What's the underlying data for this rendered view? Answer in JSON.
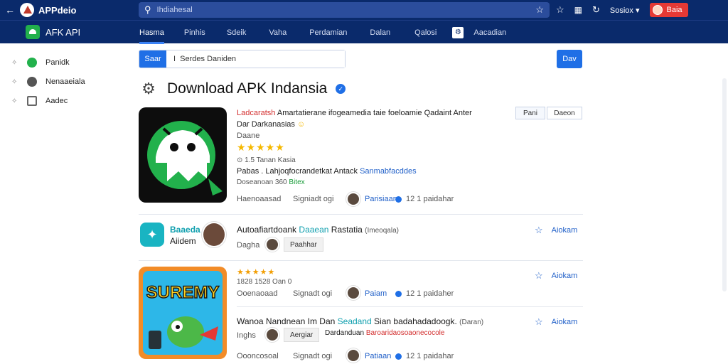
{
  "topbar": {
    "back_icon": "back-arrow-icon",
    "app_name": "APPdeio",
    "search_placeholder": "Ihdiahesal",
    "lang": "Sosiox",
    "user_label": "Baia"
  },
  "navbar": {
    "section": "AFK API",
    "tabs": [
      "Hasma",
      "Pinhis",
      "Sdeik",
      "Vaha",
      "Perdamian",
      "Dalan",
      "Qalosi",
      "Aacadian"
    ]
  },
  "sidebar": {
    "items": [
      "Panidk",
      "Nenaaeiala",
      "Aadec"
    ]
  },
  "filter": {
    "sort_label": "Saar",
    "input_value": "I  Serdes Daniden",
    "dev_label": "Dav"
  },
  "page_title": "Download APK Indansia",
  "featured": {
    "title_red": "Ladcaratsh",
    "title_rest": "Amartatierane ifogeamedia taie  foeloamie Qadaint Anter",
    "subtitle": "Dar Darkanasias",
    "category": "Daane",
    "rating_stars": 5,
    "meta": "⊙  1.5  Tanan Kasia",
    "desc_dark": "Pabas . Lahjoqfocrandetkat Antack",
    "desc_blue": "Sanmabfacddes",
    "size_dark": "Doseanoan 360",
    "size_green": "Bitex",
    "btn_primary": "Pani",
    "btn_secondary": "Daeon",
    "footer_left": "Haenoaasad",
    "footer_mid": "Signiadt ogi",
    "footer_author": "Parisiaan",
    "footer_right": "12 1 paidahar"
  },
  "apps": [
    {
      "brand_top": "Baaeda",
      "brand_bottom": "Aiidem",
      "title_dark": "Autoafiartdoank",
      "title_teal": "Daaean",
      "title_rest": "Rastatia",
      "tag_inline": "Imeoqala",
      "sub_left": "Dagha",
      "sub_tag": "Paahhar",
      "fav_label": "Aiokam"
    },
    {
      "rating_stars": 5,
      "meta": "1828  1528  Oan 0",
      "footer_left": "Ooenaoaad",
      "footer_mid": "Signadt ogi",
      "footer_author": "Paiam",
      "footer_right": "12 1 paidaher",
      "fav_label": "Aiokam"
    },
    {
      "title_dark": "Wanoa Nandnean Im Dan",
      "title_teal": "Seadand",
      "title_rest": "Sian badahadadoogk.",
      "tag_inline": "Daran",
      "sub_left": "Inghs",
      "sub_tag": "Aergiar",
      "sub_dark": "Dardanduan",
      "sub_red": "Baroaridaosoaonecocole",
      "footer_left": "Oooncosoal",
      "footer_mid": "Signadt ogi",
      "footer_author": "Patiaan",
      "footer_right": "12 1 paidahar",
      "fav_label": "Aiokam"
    }
  ],
  "colors": {
    "topbar": "#0a2a6b",
    "accent": "#1f6fe6",
    "android_green": "#22b14c",
    "star": "#f5b800",
    "user_button": "#e53935"
  }
}
